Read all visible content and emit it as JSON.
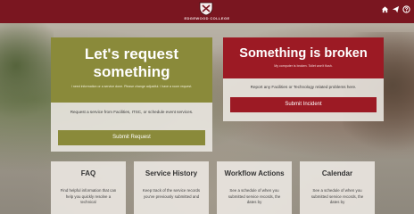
{
  "header": {
    "college_name": "EDGEWOOD COLLEGE",
    "icons": [
      "home-icon",
      "send-icon",
      "help-icon"
    ],
    "background_color": "#7a1620"
  },
  "request_panel": {
    "title": "Let's request something",
    "subtitle": "I need information or a service done. Please change adjustful. I have a room request.",
    "description": "Request a service from Facilities, ITSC, or schedule event services.",
    "button_label": "Submit Request",
    "accent_color": "#8a8a3a"
  },
  "incident_panel": {
    "title": "Something is broken",
    "subtitle": "My computer is broken. Toilet won't flush.",
    "description": "Report any Facilities or Technology related problems here.",
    "button_label": "Submit Incident",
    "accent_color": "#9c1a24"
  },
  "cards": [
    {
      "title": "FAQ",
      "description": "Find helpful information that can help you quickly resolve a technical"
    },
    {
      "title": "Service History",
      "description": "Keep track of the service records you've previously submitted and"
    },
    {
      "title": "Workflow Actions",
      "description": "See a schedule of when you submitted service records, the dates by"
    },
    {
      "title": "Calendar",
      "description": "See a schedule of when you submitted service records, the dates by"
    }
  ]
}
